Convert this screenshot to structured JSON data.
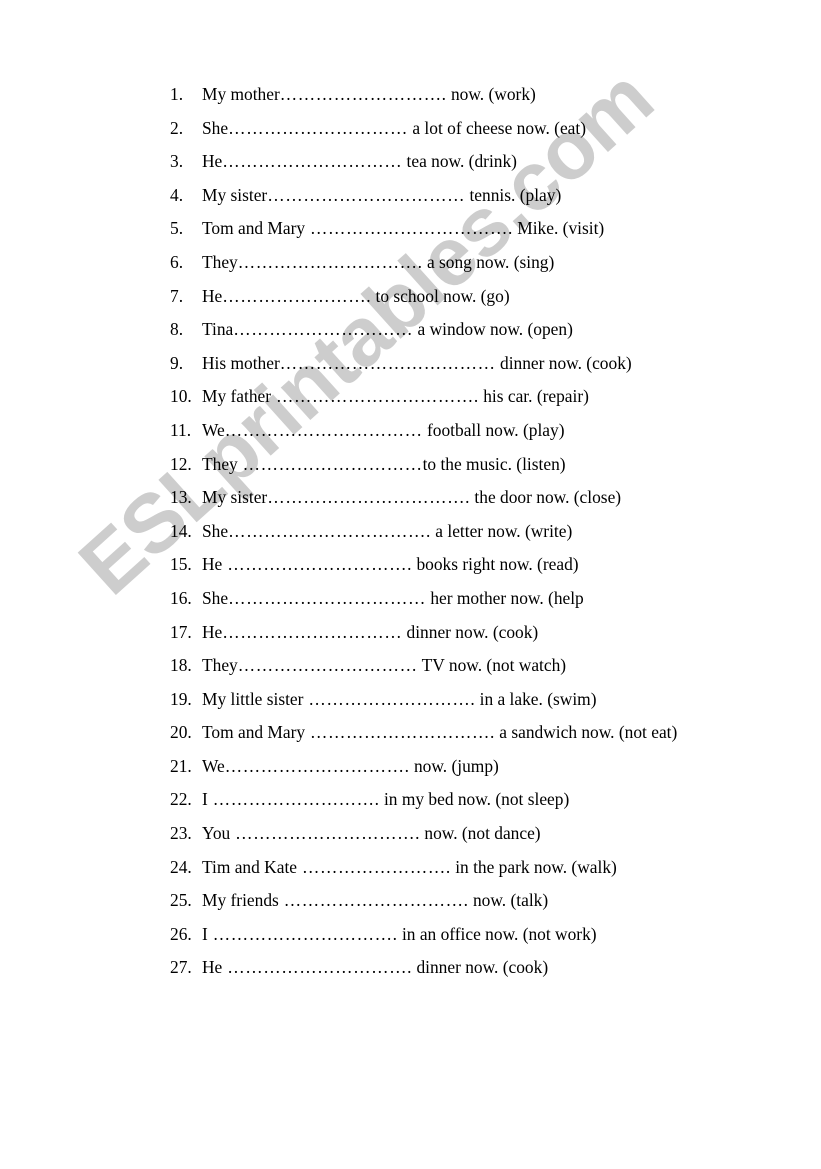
{
  "document": {
    "type": "esl-grammar-worksheet",
    "background_color": "#ffffff",
    "text_color": "#000000"
  },
  "watermark": {
    "text": "ESLprintables.com",
    "color": "#cdcdcd",
    "rotation_degrees": -42
  },
  "exercise": {
    "items": [
      {
        "number": "1.",
        "subject": "My mother",
        "dots": "……………………….",
        "tail": " now. (work)"
      },
      {
        "number": "2.",
        "subject": " She",
        "dots": "…………………………",
        "tail": " a lot of cheese now. (eat)"
      },
      {
        "number": "3.",
        "subject": " He",
        "dots": "…………………………",
        "tail": " tea now. (drink)"
      },
      {
        "number": "4.",
        "subject": " My sister",
        "dots": "……………………………",
        "tail": " tennis. (play)"
      },
      {
        "number": "5.",
        "subject": " Tom and Mary",
        "dots": " …………………………….",
        "tail": "  Mike. (visit)"
      },
      {
        "number": "6.",
        "subject": " They",
        "dots": "………………………….",
        "tail": " a song now. (sing)"
      },
      {
        "number": "7.",
        "subject": " He",
        "dots": "…………………….",
        "tail": " to school now. (go)"
      },
      {
        "number": "8.",
        "subject": " Tina",
        "dots": "…………………………",
        "tail": " a window  now. (open)"
      },
      {
        "number": "9.",
        "subject": " His mother",
        "dots": "………………………………",
        "tail": " dinner now.  (cook)"
      },
      {
        "number": "10.",
        "subject": "My father",
        "dots": " …………………………….",
        "tail": " his car. (repair)"
      },
      {
        "number": "11.",
        "subject": "We",
        "dots": "……………………………",
        "tail": " football now. (play)"
      },
      {
        "number": "12.",
        "subject": "They",
        "dots": " …………………………",
        "tail": "to the music. (listen)"
      },
      {
        "number": "13.",
        "subject": "My sister",
        "dots": "…………………………….",
        "tail": " the door now.  (close)"
      },
      {
        "number": "14.",
        "subject": "She",
        "dots": "…………………………….",
        "tail": " a letter  now. (write)"
      },
      {
        "number": "15.",
        "subject": "He",
        "dots": " ………………………….",
        "tail": " books  right now. (read)"
      },
      {
        "number": "16.",
        "subject": "She",
        "dots": "……………………………",
        "tail": " her mother now. (help"
      },
      {
        "number": "17.",
        "subject": "He",
        "dots": "…………………………",
        "tail": "  dinner now. (cook)"
      },
      {
        "number": "18.",
        "subject": "They",
        "dots": "…………………………",
        "tail": " TV now.     (not watch)"
      },
      {
        "number": "19.",
        "subject": "My little sister",
        "dots": " ……………………….",
        "tail": " in a lake. (swim)"
      },
      {
        "number": "20.",
        "subject": "Tom and Mary",
        "dots": " ………………………….",
        "tail": " a sandwich now. (not eat)"
      },
      {
        "number": "21.",
        "subject": "We",
        "dots": "………………………….",
        "tail": " now. (jump)"
      },
      {
        "number": "22.",
        "subject": "I",
        "dots": " ……………………….",
        "tail": " in my bed now. (not sleep)"
      },
      {
        "number": "23.",
        "subject": "You",
        "dots": " ………………………….",
        "tail": " now. (not dance)"
      },
      {
        "number": "24.",
        "subject": "Tim and Kate",
        "dots": " …………………….",
        "tail": " in the park now. (walk)"
      },
      {
        "number": "25.",
        "subject": "My friends",
        "dots": " ………………………….",
        "tail": " now. (talk)"
      },
      {
        "number": "26.",
        "subject": "I",
        "dots": " ………………………….",
        "tail": " in an office now. (not work)"
      },
      {
        "number": "27.",
        "subject": "He",
        "dots": " ………………………….",
        "tail": "  dinner now. (cook)"
      }
    ]
  }
}
